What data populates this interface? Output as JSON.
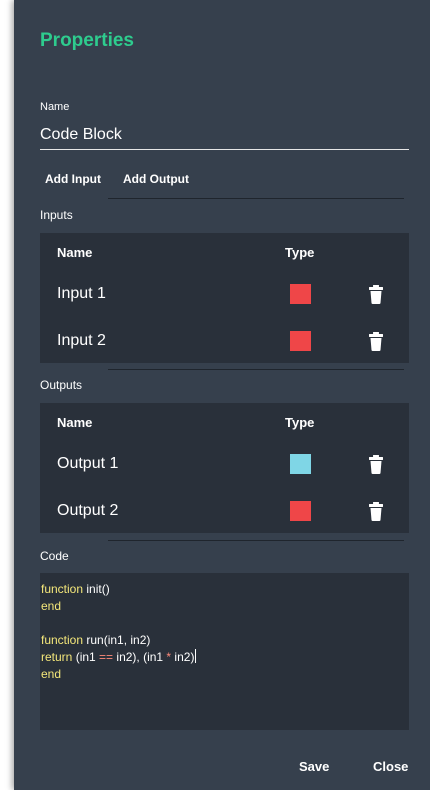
{
  "panel": {
    "title": "Properties",
    "name_label": "Name",
    "name_value": "Code Block",
    "add_input_label": "Add Input",
    "add_output_label": "Add Output"
  },
  "inputs": {
    "section_label": "Inputs",
    "col_name": "Name",
    "col_type": "Type",
    "rows": [
      {
        "name": "Input 1",
        "type_color": "#ef4648"
      },
      {
        "name": "Input 2",
        "type_color": "#ef4648"
      }
    ]
  },
  "outputs": {
    "section_label": "Outputs",
    "col_name": "Name",
    "col_type": "Type",
    "rows": [
      {
        "name": "Output 1",
        "type_color": "#7fd6e6"
      },
      {
        "name": "Output 2",
        "type_color": "#ef4648"
      }
    ]
  },
  "code": {
    "section_label": "Code",
    "lines": [
      [
        {
          "t": "function",
          "k": "kw"
        },
        {
          "t": " init()",
          "k": ""
        }
      ],
      [
        {
          "t": "end",
          "k": "kw"
        }
      ],
      [],
      [
        {
          "t": "function",
          "k": "kw"
        },
        {
          "t": " run(in1, in2)",
          "k": ""
        }
      ],
      [
        {
          "t": "return",
          "k": "kw"
        },
        {
          "t": " (in1 ",
          "k": ""
        },
        {
          "t": "==",
          "k": "op"
        },
        {
          "t": " in2), (in1 ",
          "k": ""
        },
        {
          "t": "*",
          "k": "op"
        },
        {
          "t": " in2)",
          "k": ""
        }
      ],
      [
        {
          "t": "end",
          "k": "kw"
        }
      ]
    ]
  },
  "footer": {
    "save_label": "Save",
    "close_label": "Close"
  },
  "colors": {
    "accent": "#2ecc8e",
    "panel_bg": "#36404d",
    "table_bg": "#29303a",
    "keyword": "#f4e77a",
    "operator": "#ff8a7a"
  },
  "icons": {
    "delete": "trash-icon"
  }
}
